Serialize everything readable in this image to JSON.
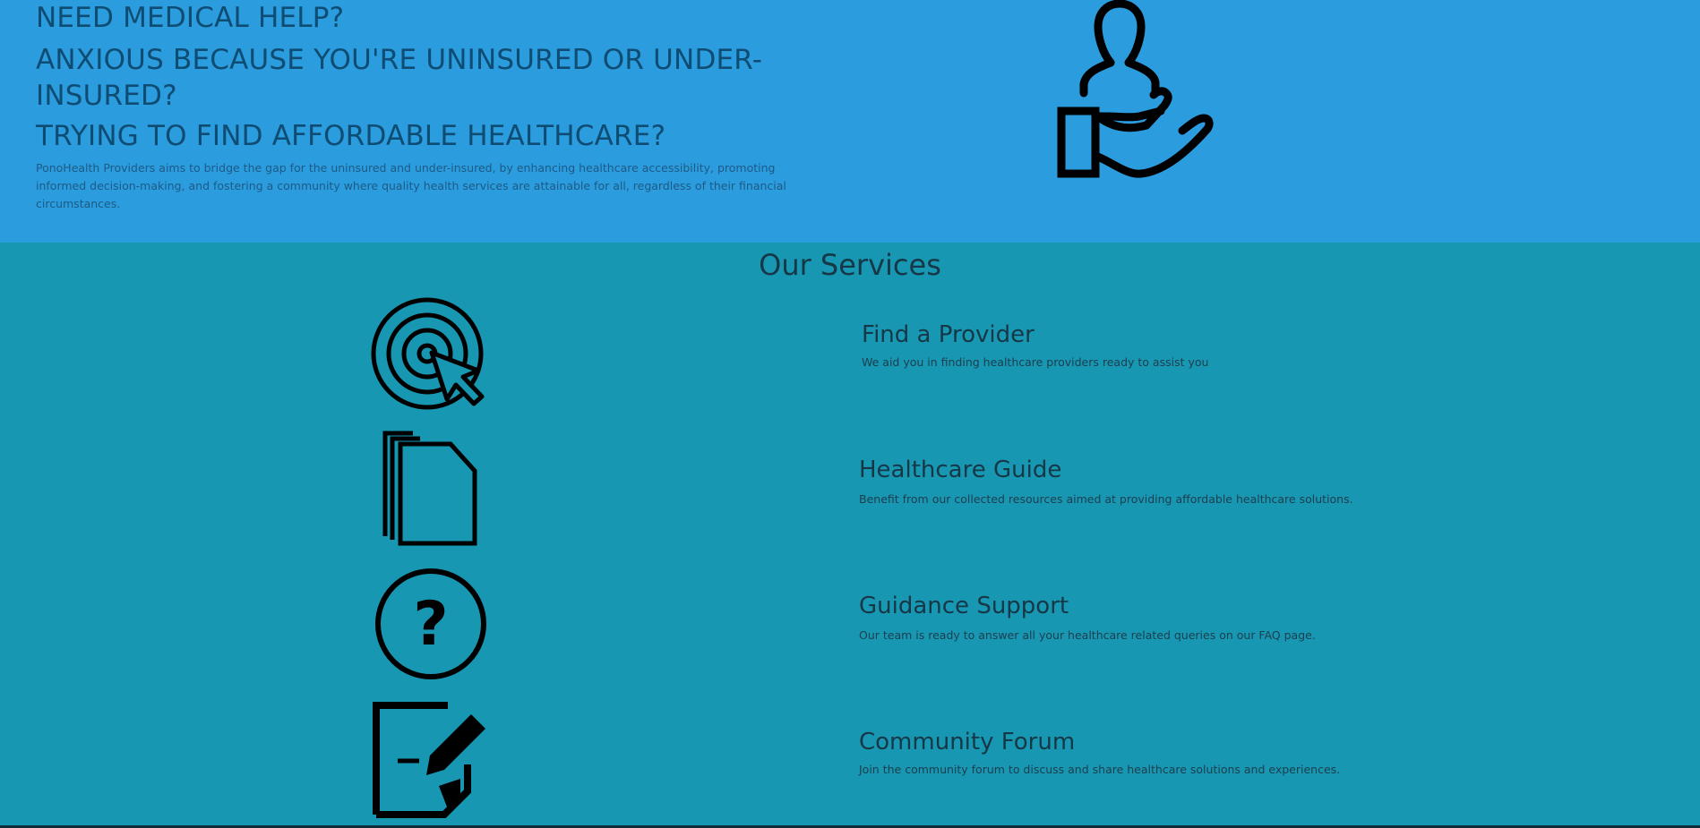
{
  "hero": {
    "headline_1": "NEED MEDICAL HELP?",
    "headline_2": "ANXIOUS BECAUSE YOU'RE UNINSURED OR UNDER-INSURED?",
    "headline_3": "TRYING TO FIND AFFORDABLE HEALTHCARE?",
    "description": "PonoHealth Providers aims to bridge the gap for the uninsured and under-insured, by enhancing healthcare accessibility, promoting informed decision-making, and fostering a community where quality health services are attainable for all, regardless of their financial circumstances.",
    "icon": "hand-holding-person-icon"
  },
  "services": {
    "title": "Our Services",
    "items": [
      {
        "title": "Find a Provider",
        "description": "We aid you in finding healthcare providers ready to assist you",
        "icon": "target-cursor-icon"
      },
      {
        "title": "Healthcare Guide",
        "description": "Benefit from our collected resources aimed at providing affordable healthcare solutions.",
        "icon": "documents-icon"
      },
      {
        "title": "Guidance Support",
        "description": "Our team is ready to answer all your healthcare related queries on our FAQ page.",
        "icon": "question-circle-icon"
      },
      {
        "title": "Community Forum",
        "description": "Join the community forum to discuss and share healthcare solutions and experiences.",
        "icon": "note-pen-icon"
      }
    ]
  },
  "colors": {
    "hero_bg": "#2b9cdd",
    "services_bg": "#1897b3",
    "heading_text": "#0f4c73",
    "dark_text": "#163746"
  }
}
